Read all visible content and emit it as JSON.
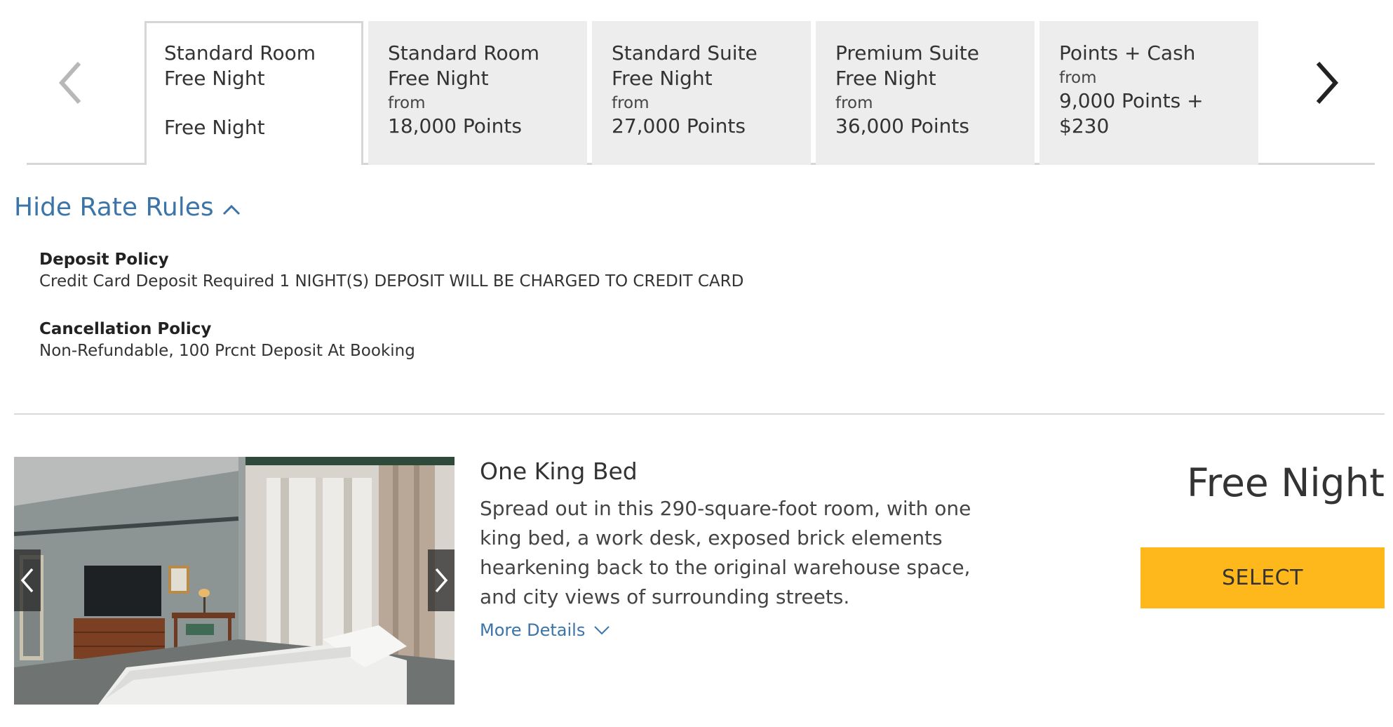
{
  "tabs": [
    {
      "title": "Standard Room\nFree Night",
      "from": "",
      "price": "Free Night"
    },
    {
      "title": "Standard Room\nFree Night",
      "from": "from",
      "price": "18,000 Points"
    },
    {
      "title": "Standard Suite\nFree Night",
      "from": "from",
      "price": "27,000 Points"
    },
    {
      "title": "Premium Suite\nFree Night",
      "from": "from",
      "price": "36,000 Points"
    },
    {
      "title": "Points + Cash\n",
      "from": "from",
      "price": "9,000 Points +\n$230"
    }
  ],
  "icons": {
    "prev": "chevron-left-icon",
    "next": "chevron-right-icon",
    "collapse": "chevron-up-icon",
    "expand": "chevron-down-icon"
  },
  "rate_rules": {
    "toggle_label": "Hide Rate Rules",
    "deposit_title": "Deposit Policy",
    "deposit_text": "Credit Card Deposit Required 1 NIGHT(S) DEPOSIT WILL BE CHARGED TO CREDIT CARD",
    "cancellation_title": "Cancellation Policy",
    "cancellation_text": "Non-Refundable, 100 Prcnt Deposit At Booking"
  },
  "room": {
    "name": "One King Bed",
    "description": "Spread out in this 290-square-foot room, with one king bed, a work desk, exposed brick elements hearkening back to the original warehouse space, and city views of surrounding streets.",
    "more_details": "More Details",
    "price": "Free Night",
    "select_label": "SELECT"
  },
  "colors": {
    "accent": "#3b74a8",
    "select_button": "#ffb81c",
    "tab_bg": "#ededed"
  }
}
